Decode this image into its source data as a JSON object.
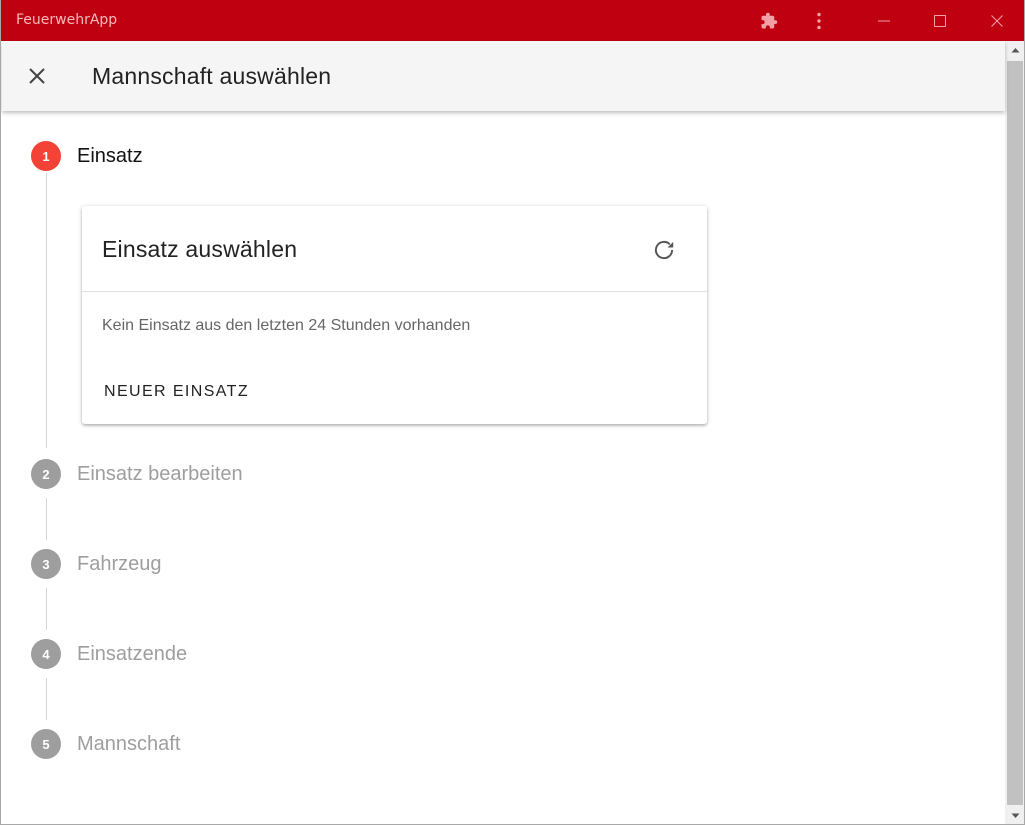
{
  "window": {
    "title": "FeuerwehrApp"
  },
  "titlebar_icons": {
    "extensions": "puzzle-icon",
    "menu": "more-vertical-icon",
    "minimize": "minimize-icon",
    "maximize": "maximize-icon",
    "close": "close-icon"
  },
  "header": {
    "close_icon": "close-icon",
    "title": "Mannschaft auswählen"
  },
  "stepper": {
    "steps": [
      {
        "number": "1",
        "label": "Einsatz",
        "state": "active"
      },
      {
        "number": "2",
        "label": "Einsatz bearbeiten",
        "state": "inactive"
      },
      {
        "number": "3",
        "label": "Fahrzeug",
        "state": "inactive"
      },
      {
        "number": "4",
        "label": "Einsatzende",
        "state": "inactive"
      },
      {
        "number": "5",
        "label": "Mannschaft",
        "state": "inactive"
      }
    ]
  },
  "card": {
    "title": "Einsatz auswählen",
    "refresh_icon": "refresh-icon",
    "empty_text": "Kein Einsatz aus den letzten 24 Stunden vorhanden",
    "new_button": "NEUER EINSATZ"
  },
  "colors": {
    "titlebar": "#bf0010",
    "active_step": "#f44336",
    "inactive_step": "#9e9e9e"
  }
}
